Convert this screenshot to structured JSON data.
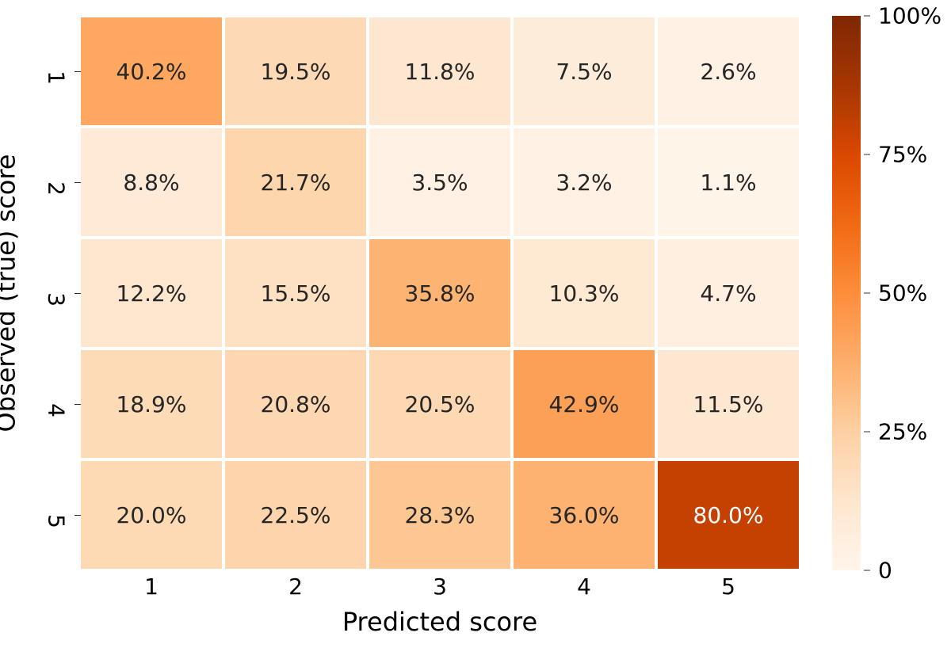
{
  "chart_data": {
    "type": "heatmap",
    "xlabel": "Predicted score",
    "ylabel": "Observed (true) score",
    "x_categories": [
      "1",
      "2",
      "3",
      "4",
      "5"
    ],
    "y_categories": [
      "1",
      "2",
      "3",
      "4",
      "5"
    ],
    "values": [
      [
        40.2,
        19.5,
        11.8,
        7.5,
        2.6
      ],
      [
        8.8,
        21.7,
        3.5,
        3.2,
        1.1
      ],
      [
        12.2,
        15.5,
        35.8,
        10.3,
        4.7
      ],
      [
        18.9,
        20.8,
        20.5,
        42.9,
        11.5
      ],
      [
        20.0,
        22.5,
        28.3,
        36.0,
        80.0
      ]
    ],
    "value_suffix": "%",
    "vmin": 0,
    "vmax": 100,
    "colorbar_ticks": [
      {
        "pos": 0,
        "label": "0"
      },
      {
        "pos": 25,
        "label": "25%"
      },
      {
        "pos": 50,
        "label": "50%"
      },
      {
        "pos": 75,
        "label": "75%"
      },
      {
        "pos": 100,
        "label": "100%"
      }
    ],
    "colormap": "Oranges",
    "text_light_threshold": 60
  }
}
